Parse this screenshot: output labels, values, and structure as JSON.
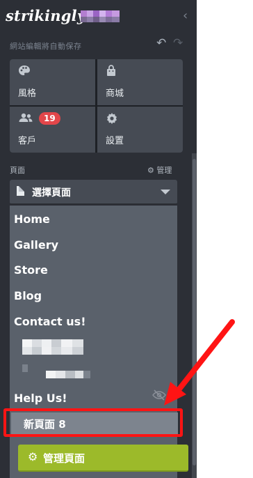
{
  "logo": "strikingly",
  "header": {
    "autosave": "網站編輯將自動保存"
  },
  "grid": [
    {
      "label": "風格",
      "icon": "palette-icon"
    },
    {
      "label": "商城",
      "icon": "shopping-bag-icon"
    },
    {
      "label": "客戶",
      "icon": "users-icon",
      "badge": "19"
    },
    {
      "label": "設置",
      "icon": "gear-icon"
    }
  ],
  "pages": {
    "section_label": "頁面",
    "manage_label": "管理",
    "select_label": "選擇頁面",
    "items": [
      "Home",
      "Gallery",
      "Store",
      "Blog",
      "Contact us!"
    ],
    "help_item": "Help Us!",
    "new_page": "新頁面 8",
    "manage_button": "管理頁面"
  },
  "colors": {
    "panel": "#2c2f36",
    "accent": "#9cba2a",
    "badge": "#e3464a",
    "highlight": "#ff1414"
  }
}
